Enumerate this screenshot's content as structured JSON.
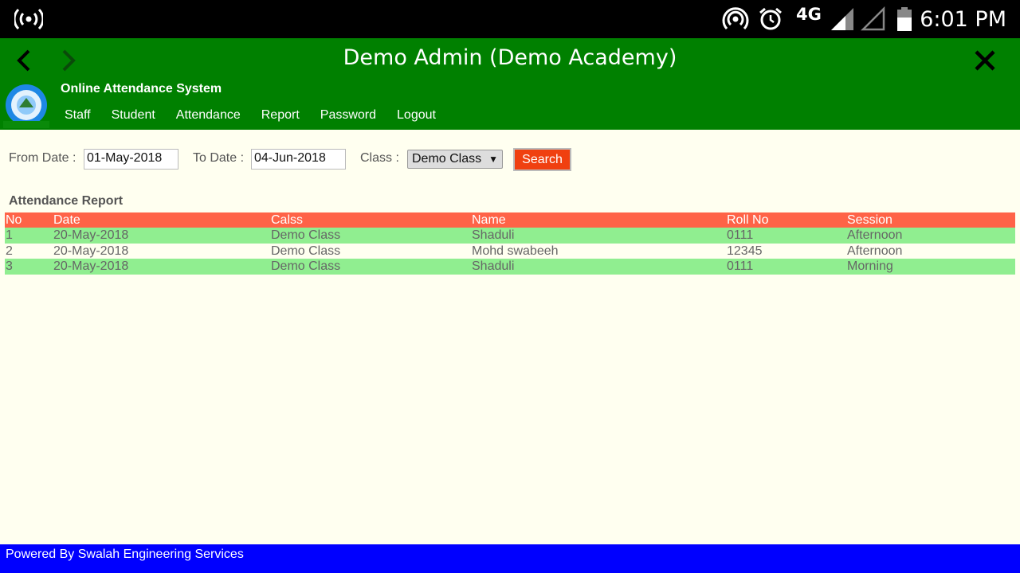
{
  "status_bar": {
    "time": "6:01 PM",
    "network": "4G",
    "icons": [
      "broadcast-icon",
      "hotspot-icon",
      "alarm-icon",
      "signal-icon",
      "signal-empty-icon",
      "battery-icon"
    ]
  },
  "header": {
    "title": "Demo Admin (Demo Academy)",
    "app_name": "Online Attendance System",
    "menu": [
      "Staff",
      "Student",
      "Attendance",
      "Report",
      "Password",
      "Logout"
    ],
    "background": "#008000"
  },
  "filters": {
    "from_label": "From Date :",
    "from_value": "01-May-2018",
    "to_label": "To Date :",
    "to_value": "04-Jun-2018",
    "class_label": "Class :",
    "class_value": "Demo Class",
    "search_label": "Search"
  },
  "report": {
    "title": "Attendance Report",
    "columns": [
      "No",
      "Date",
      "Calss",
      "Name",
      "Roll No",
      "Session"
    ],
    "rows": [
      [
        "1",
        "20-May-2018",
        "Demo Class",
        "Shaduli",
        "0111",
        "Afternoon"
      ],
      [
        "2",
        "20-May-2018",
        "Demo Class",
        "Mohd swabeeh",
        "12345",
        "Afternoon"
      ],
      [
        "3",
        "20-May-2018",
        "Demo Class",
        "Shaduli",
        "0111",
        "Morning"
      ]
    ],
    "header_color": "#ff6347",
    "stripe_color": "#90ee90"
  },
  "footer": {
    "text": "Powered By Swalah Engineering Services",
    "background": "#0000ff"
  }
}
